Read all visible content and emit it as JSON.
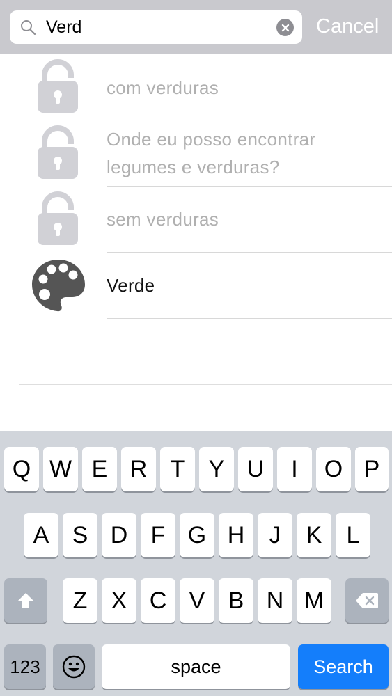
{
  "search": {
    "query": "Verd",
    "cancel_label": "Cancel"
  },
  "results": [
    {
      "label_line1": "com verduras",
      "label_line2": "",
      "icon": "lock-icon",
      "dimmed": true
    },
    {
      "label_line1": "Onde eu posso encontrar",
      "label_line2": "legumes e verduras?",
      "icon": "lock-icon",
      "dimmed": true
    },
    {
      "label_line1": "sem verduras",
      "label_line2": "",
      "icon": "lock-icon",
      "dimmed": true
    },
    {
      "label_line1": "Verde",
      "label_line2": "",
      "icon": "palette-icon",
      "dimmed": false
    }
  ],
  "keyboard": {
    "row1": [
      "Q",
      "W",
      "E",
      "R",
      "T",
      "Y",
      "U",
      "I",
      "O",
      "P"
    ],
    "row2": [
      "A",
      "S",
      "D",
      "F",
      "G",
      "H",
      "J",
      "K",
      "L"
    ],
    "row3": [
      "Z",
      "X",
      "C",
      "V",
      "B",
      "N",
      "M"
    ],
    "numbers_label": "123",
    "space_label": "space",
    "search_label": "Search"
  },
  "colors": {
    "accent": "#147efb",
    "header_bg": "#c9c9ce",
    "keyboard_bg": "#d1d5db",
    "lock_icon": "#d1d1d6",
    "palette_icon": "#555555"
  }
}
